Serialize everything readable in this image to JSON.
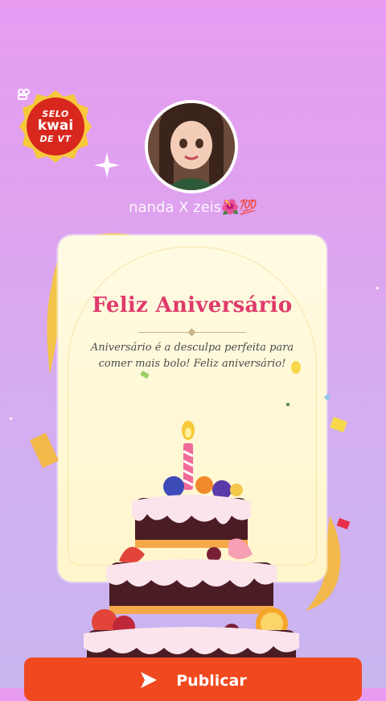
{
  "seal": {
    "line1": "SELO",
    "brand": "kwai",
    "line3": "DE VT",
    "color": "#d8281e",
    "border": "#f7c93a"
  },
  "profile": {
    "username": "nanda X zeis🌺💯",
    "avatar": "avatar-photo"
  },
  "card": {
    "title": "Feliz Aniversário",
    "message_line1": "Aniversário é a desculpa perfeita para",
    "message_line2": "comer mais bolo! Feliz aniversário!",
    "title_color": "#e03a6c"
  },
  "action": {
    "publish_label": "Publicar",
    "color": "#f1491f"
  },
  "icons": [
    "sparkle-icon",
    "kwai-logo-icon",
    "send-arrow-icon",
    "birthday-cake-illustration"
  ]
}
